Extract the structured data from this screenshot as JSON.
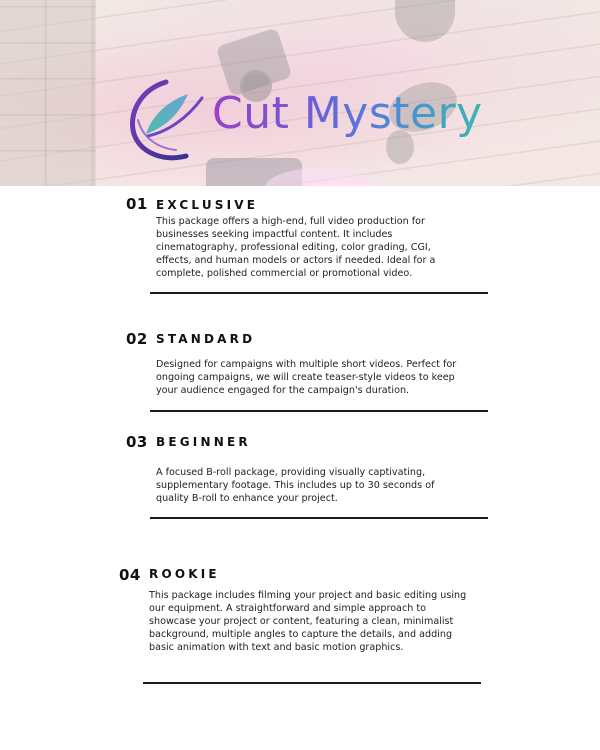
{
  "logo": {
    "name": "Cut Mystery"
  },
  "packages": [
    {
      "number": "01",
      "title": "EXCLUSIVE",
      "description": "This package offers a high-end, full video production for businesses seeking impactful content. It includes cinematography, professional editing, color grading, CGI, effects, and human models or actors if needed. Ideal for a complete, polished commercial or promotional video."
    },
    {
      "number": "02",
      "title": "STANDARD",
      "description": "Designed for campaigns with multiple short videos. Perfect for ongoing campaigns, we will create teaser-style videos to keep your audience engaged for the campaign's duration."
    },
    {
      "number": "03",
      "title": "BEGINNER",
      "description": "A focused B-roll package, providing visually captivating, supplementary footage. This includes up to 30 seconds of quality B-roll to enhance your project."
    },
    {
      "number": "04",
      "title": "ROOKIE",
      "description": "This package includes filming your project and basic editing using our equipment. A straightforward and simple approach to showcase your project or content, featuring a clean, minimalist background, multiple angles to capture the details, and adding basic animation with text and basic motion graphics."
    }
  ],
  "colors": {
    "logo_gradient_start": "#9a3fc9",
    "logo_gradient_mid": "#4f86d6",
    "logo_gradient_end": "#3bb9b0",
    "text": "#111111",
    "rule": "#1b1b1b"
  }
}
